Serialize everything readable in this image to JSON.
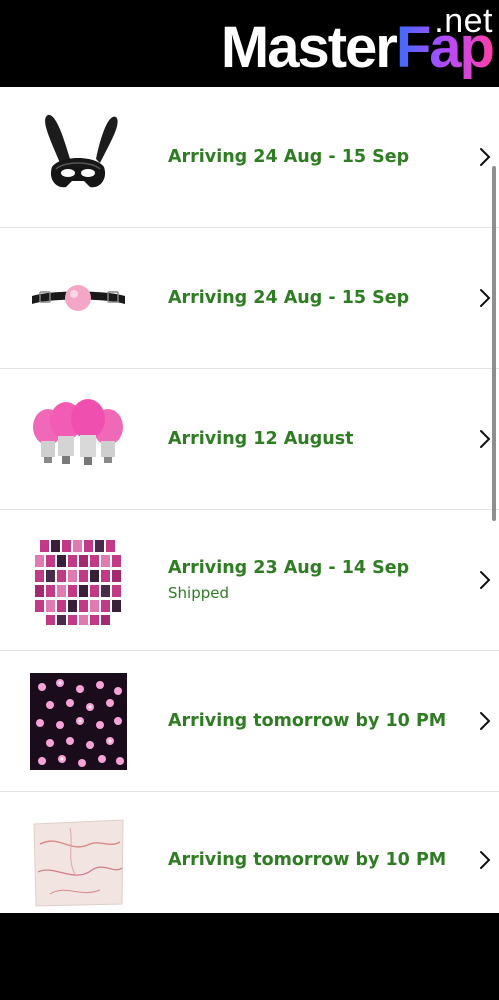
{
  "watermark": {
    "name_white": "Master",
    "name_gradient": "Fap",
    "tld": ".net"
  },
  "orders": [
    {
      "status": "Arriving 24 Aug - 15 Sep",
      "sub": "",
      "thumb": "bunny-mask"
    },
    {
      "status": "Arriving 24 Aug - 15 Sep",
      "sub": "",
      "thumb": "ball-gag"
    },
    {
      "status": "Arriving 12 August",
      "sub": "",
      "thumb": "pink-bulbs"
    },
    {
      "status": "Arriving 23 Aug - 14 Sep",
      "sub": "Shipped",
      "thumb": "photo-collage"
    },
    {
      "status": "Arriving tomorrow by 10 PM",
      "sub": "",
      "thumb": "fairy-lights"
    },
    {
      "status": "Arriving tomorrow by 10 PM",
      "sub": "",
      "thumb": "marble-tapestry"
    }
  ],
  "colors": {
    "status": "#2f7d23",
    "divider": "#e3e3e3",
    "background": "#ffffff",
    "chrome": "#000000"
  }
}
